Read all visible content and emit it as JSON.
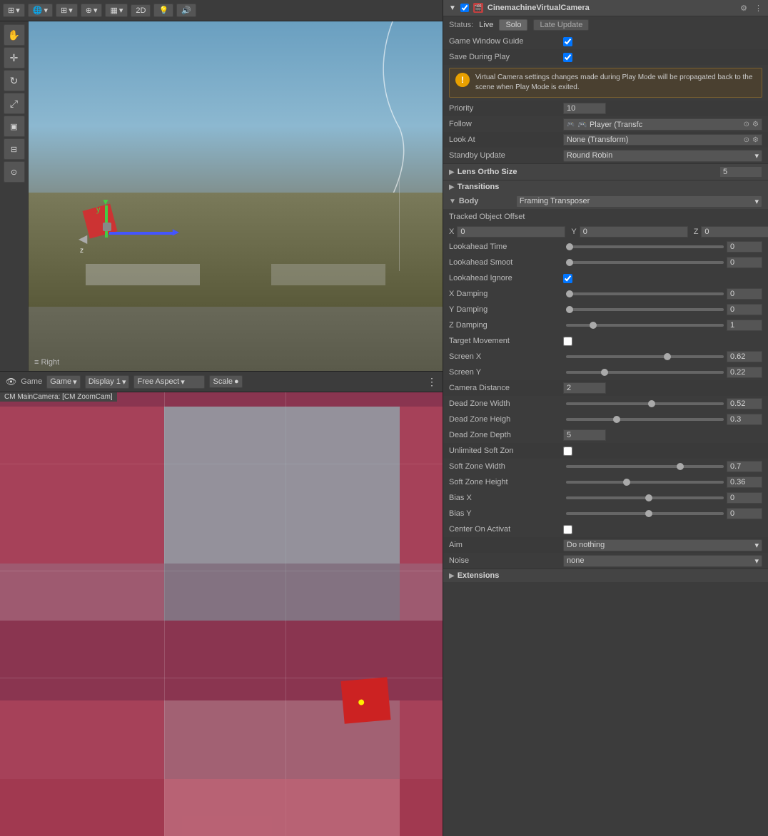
{
  "toolbar": {
    "items": [
      "⊞",
      "🌐",
      "##",
      "⊕",
      "▦",
      "2D",
      "💡",
      "🔊"
    ]
  },
  "sceneView": {
    "label": "≡ Right"
  },
  "gameToolbar": {
    "label": "Game",
    "displayLabel": "Display 1",
    "aspectLabel": "Free Aspect",
    "scaleLabel": "Scale",
    "moreIcon": "⋮"
  },
  "gameCameraLabel": "CM MainCamera: [CM ZoomCam]",
  "inspector": {
    "componentName": "CinemachineVirtualCamera",
    "statusLabel": "Status:",
    "statusValue": "Live",
    "soloBtn": "Solo",
    "lateUpdateBtn": "Late Update",
    "gameWindowGuideLabel": "Game Window Guide",
    "saveDuringPlayLabel": "Save During Play",
    "infoText": "Virtual Camera settings changes made during Play Mode will be propagated back to the scene when Play Mode is exited.",
    "priorityLabel": "Priority",
    "priorityValue": "10",
    "followLabel": "Follow",
    "followValue": "🎮 Player (Transfc",
    "lookAtLabel": "Look At",
    "lookAtValue": "None (Transform)",
    "standbyUpdateLabel": "Standby Update",
    "standbyUpdateValue": "Round Robin",
    "lensOrthoLabel": "Lens Ortho Size",
    "lensOrthoValue": "5",
    "transitionsLabel": "Transitions",
    "bodyLabel": "Body",
    "bodyValue": "Framing Transposer",
    "trackedOffsetLabel": "Tracked Object Offset",
    "offsetX": "0",
    "offsetY": "0",
    "offsetZ": "0",
    "lookaheadTimeLabel": "Lookahead Time",
    "lookaheadTimeValue": "0",
    "lookaheadTimePos": "0%",
    "lookaheadSmoothLabel": "Lookahead Smoot",
    "lookaheadSmoothValue": "0",
    "lookaheadSmoothPos": "0%",
    "lookaheadIgnoreLabel": "Lookahead Ignore",
    "xDampingLabel": "X Damping",
    "xDampingValue": "0",
    "xDampingPos": "0%",
    "yDampingLabel": "Y Damping",
    "yDampingValue": "0",
    "yDampingPos": "0%",
    "zDampingLabel": "Z Damping",
    "zDampingValue": "1",
    "zDampingPos": "15%",
    "targetMovementLabel": "Target Movement",
    "screenXLabel": "Screen X",
    "screenXValue": "0.62",
    "screenXPos": "62%",
    "screenYLabel": "Screen Y",
    "screenYValue": "0.22",
    "screenYPos": "22%",
    "cameraDistLabel": "Camera Distance",
    "cameraDistValue": "2",
    "deadZoneWidthLabel": "Dead Zone Width",
    "deadZoneWidthValue": "0.52",
    "deadZoneWidthPos": "52%",
    "deadZoneHeightLabel": "Dead Zone Heigh",
    "deadZoneHeightValue": "0.3",
    "deadZoneHeightPos": "30%",
    "deadZoneDepthLabel": "Dead Zone Depth",
    "deadZoneDepthValue": "5",
    "unlimitedSoftLabel": "Unlimited Soft Zon",
    "softZoneWidthLabel": "Soft Zone Width",
    "softZoneWidthValue": "0.7",
    "softZoneWidthPos": "70%",
    "softZoneHeightLabel": "Soft Zone Height",
    "softZoneHeightValue": "0.36",
    "softZoneHeightPos": "36%",
    "biasXLabel": "Bias X",
    "biasXValue": "0",
    "biasXPos": "50%",
    "biasYLabel": "Bias Y",
    "biasYValue": "0",
    "biasYPos": "50%",
    "centerOnActivatLabel": "Center On Activat",
    "aimLabel": "Aim",
    "aimValue": "Do nothing",
    "noiseLabel": "Noise",
    "noiseValue": "none",
    "extensionsLabel": "Extensions"
  }
}
